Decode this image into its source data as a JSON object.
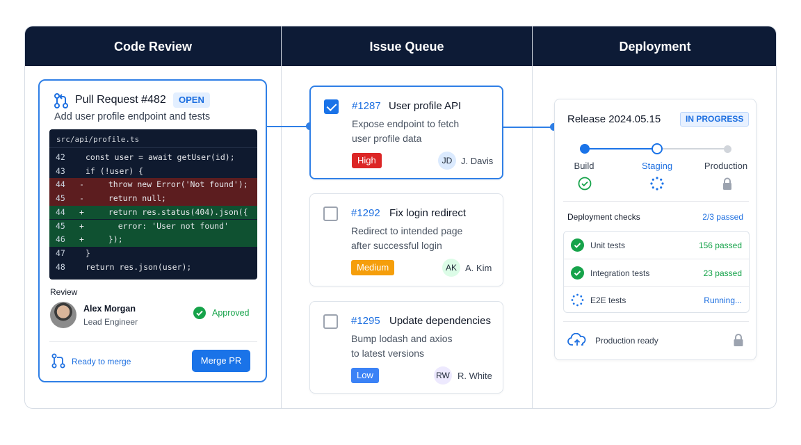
{
  "columns": {
    "code_review": "Code Review",
    "issue_queue": "Issue Queue",
    "deployment": "Deployment"
  },
  "pull_request": {
    "title": "Pull Request #482",
    "status": "OPEN",
    "subtitle": "Add user profile endpoint and tests",
    "file": "src/api/profile.ts",
    "lines": [
      {
        "num": "42",
        "marker": "",
        "text": "const user = await getUser(id);",
        "type": "ctx"
      },
      {
        "num": "43",
        "marker": "",
        "text": "if (!user) {",
        "type": "ctx"
      },
      {
        "num": "44",
        "marker": "-",
        "text": "  throw new Error('Not found');",
        "type": "del"
      },
      {
        "num": "45",
        "marker": "-",
        "text": "  return null;",
        "type": "del"
      },
      {
        "num": "44",
        "marker": "+",
        "text": "  return res.status(404).json({",
        "type": "add"
      },
      {
        "num": "45",
        "marker": "+",
        "text": "    error: 'User not found'",
        "type": "add"
      },
      {
        "num": "46",
        "marker": "+",
        "text": "  });",
        "type": "add"
      },
      {
        "num": "47",
        "marker": "",
        "text": "}",
        "type": "ctx"
      },
      {
        "num": "48",
        "marker": "",
        "text": "return res.json(user);",
        "type": "ctx"
      }
    ],
    "review_label": "Review",
    "reviewer": {
      "name": "Alex Morgan",
      "role": "Lead Engineer"
    },
    "review_status": "Approved",
    "ready_text": "Ready to merge",
    "merge_button": "Merge PR"
  },
  "issues": [
    {
      "number": "#1287",
      "title": "User profile API",
      "desc1": "Expose endpoint to fetch",
      "desc2": "user profile data",
      "priority": "High",
      "initials": "JD",
      "assignee": "J. Davis",
      "checked": true
    },
    {
      "number": "#1292",
      "title": "Fix login redirect",
      "desc1": "Redirect to intended page",
      "desc2": "after successful login",
      "priority": "Medium",
      "initials": "AK",
      "assignee": "A. Kim",
      "checked": false
    },
    {
      "number": "#1295",
      "title": "Update dependencies",
      "desc1": "Bump lodash and axios",
      "desc2": "to latest versions",
      "priority": "Low",
      "initials": "RW",
      "assignee": "R. White",
      "checked": false
    }
  ],
  "deployment": {
    "release": "Release 2024.05.15",
    "status": "IN PROGRESS",
    "stages": [
      {
        "label": "Build",
        "state": "done"
      },
      {
        "label": "Staging",
        "state": "active"
      },
      {
        "label": "Production",
        "state": "locked"
      }
    ],
    "checks_title": "Deployment checks",
    "checks_count": "2/3 passed",
    "checks": [
      {
        "name": "Unit tests",
        "status": "156 passed",
        "state": "passed"
      },
      {
        "name": "Integration tests",
        "status": "23 passed",
        "state": "passed"
      },
      {
        "name": "E2E tests",
        "status": "Running...",
        "state": "running"
      }
    ],
    "production_text": "Production ready"
  },
  "colors": {
    "header_bg": "#0d1b36",
    "accent": "#1a73e8",
    "success": "#16a34a",
    "high": "#dc2626",
    "medium": "#f59e0b",
    "low": "#3b82f6"
  }
}
